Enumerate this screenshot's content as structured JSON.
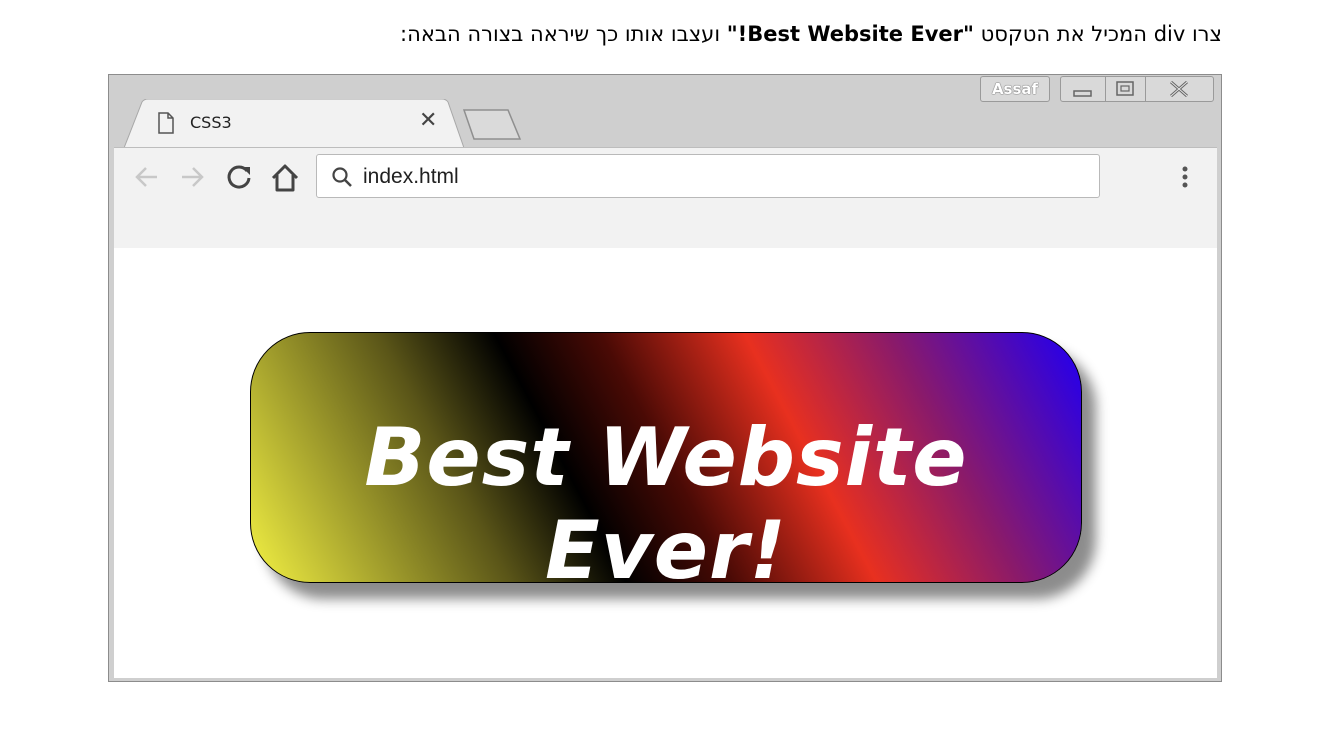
{
  "instruction": {
    "before": "צרו div המכיל את הטקסט ",
    "bold": "\"Best Website Ever!\"",
    "after": " ועצבו אותו כך שיראה בצורה הבאה:"
  },
  "browser": {
    "user_label": "Assaf",
    "tab_title": "CSS3",
    "address": "index.html"
  },
  "page": {
    "banner_text": "Best Website Ever!"
  },
  "colors": {
    "gradient": [
      "#e8e640",
      "#000000",
      "#e8301f",
      "#2a00e6"
    ]
  }
}
